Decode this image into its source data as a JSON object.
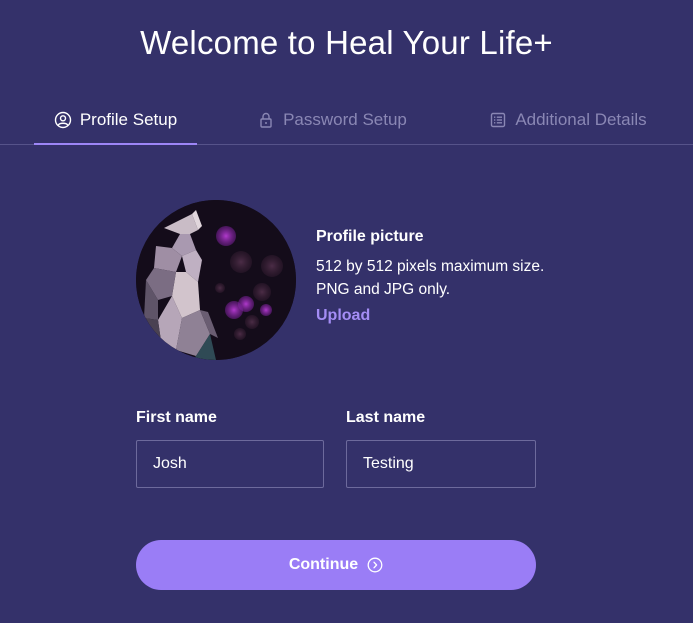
{
  "page": {
    "title": "Welcome to Heal Your Life+"
  },
  "tabs": [
    {
      "label": "Profile Setup",
      "icon": "user-circle-icon",
      "active": true
    },
    {
      "label": "Password Setup",
      "icon": "lock-icon",
      "active": false
    },
    {
      "label": "Additional Details",
      "icon": "list-icon",
      "active": false
    }
  ],
  "profile_picture": {
    "heading": "Profile picture",
    "size_note": "512 by 512 pixels maximum size.",
    "format_note": "PNG and JPG only.",
    "upload_label": "Upload"
  },
  "form": {
    "first_name": {
      "label": "First name",
      "value": "Josh"
    },
    "last_name": {
      "label": "Last name",
      "value": "Testing"
    }
  },
  "continue_button": {
    "label": "Continue",
    "icon": "chevron-right-circle-icon"
  },
  "colors": {
    "background": "#34316a",
    "accent": "#9a7df6",
    "link": "#a48df5",
    "inactive_tab": "#8a87b4"
  }
}
